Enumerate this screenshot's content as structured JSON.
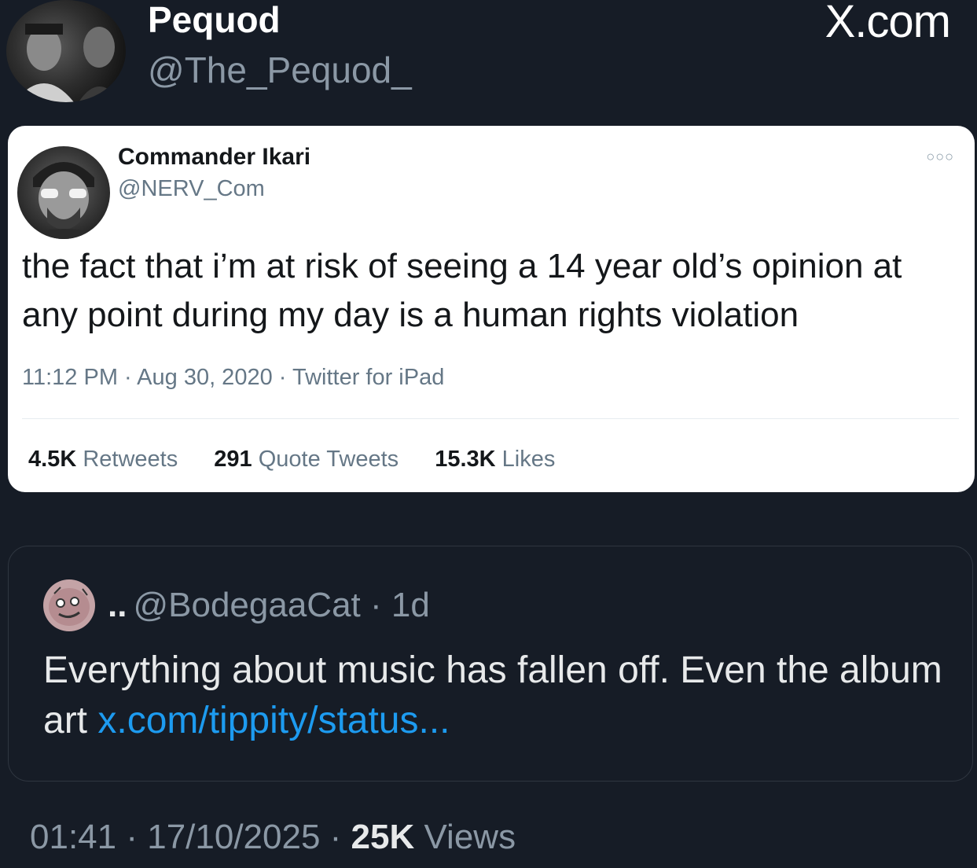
{
  "header": {
    "display_name": "Pequod",
    "handle": "@The_Pequod_",
    "site_logo": "X.com"
  },
  "embedded_tweet": {
    "display_name": "Commander Ikari",
    "handle": "@NERV_Com",
    "more_icon": "more-options-icon",
    "text": "the fact that i’m at risk of seeing a 14 year old’s opinion at any point during my day is a human rights violation",
    "time": "11:12 PM",
    "date": "Aug 30, 2020",
    "client": "Twitter for iPad",
    "sep": " · ",
    "stats": [
      {
        "count": "4.5K",
        "label": "Retweets"
      },
      {
        "count": "291",
        "label": "Quote Tweets"
      },
      {
        "count": "15.3K",
        "label": "Likes"
      }
    ]
  },
  "quote": {
    "truncated_name": "..",
    "handle": "@BodegaaCat",
    "age": "1d",
    "sep": " · ",
    "text": "Everything about music has fallen off. Even the album art",
    "link": "x.com/tippity/status..."
  },
  "footer": {
    "time": "01:41",
    "date": "17/10/2025",
    "views_count": "25K",
    "views_label": "Views",
    "sep": " · "
  },
  "colors": {
    "background": "#161c26",
    "link": "#1d9bf0",
    "muted": "#8b98a5",
    "card_bg": "#ffffff"
  }
}
